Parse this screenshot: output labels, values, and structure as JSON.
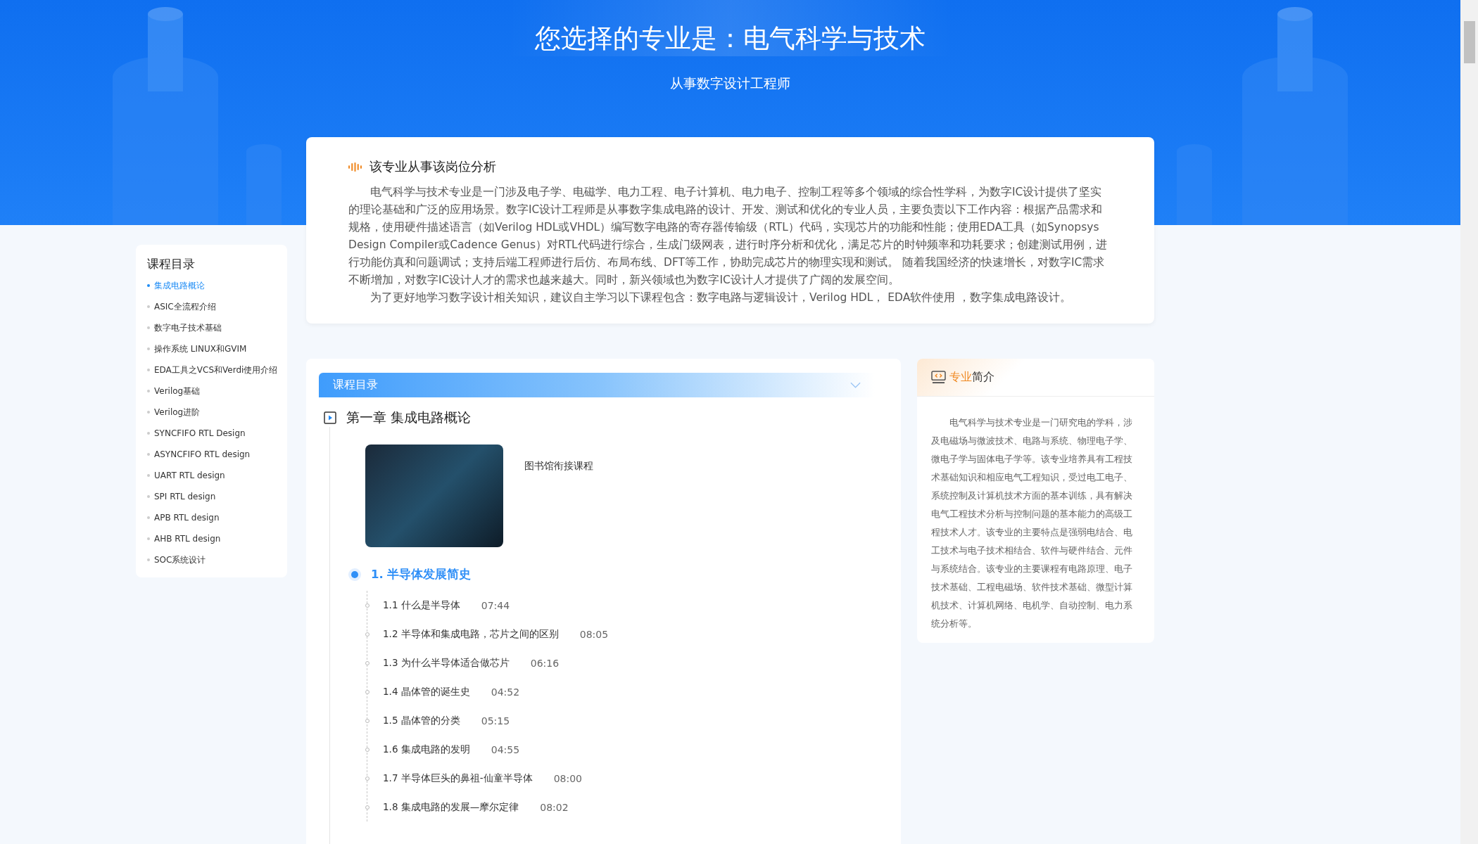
{
  "header": {
    "title": "您选择的专业是：电气科学与技术",
    "subtitle": "从事数字设计工程师"
  },
  "analysis": {
    "title": "该专业从事该岗位分析",
    "paragraphs": [
      "电气科学与技术专业是一门涉及电子学、电磁学、电力工程、电子计算机、电力电子、控制工程等多个领域的综合性学科，为数字IC设计提供了坚实的理论基础和广泛的应用场景。数字IC设计工程师是从事数字集成电路的设计、开发、测试和优化的专业人员，主要负责以下工作内容：根据产品需求和规格，使用硬件描述语言（如Verilog HDL或VHDL）编写数字电路的寄存器传输级（RTL）代码，实现芯片的功能和性能；使用EDA工具（如Synopsys Design Compiler或Cadence Genus）对RTL代码进行综合，生成门级网表，进行时序分析和优化，满足芯片的时钟频率和功耗要求；创建测试用例，进行功能仿真和问题调试；支持后端工程师进行后仿、布局布线、DFT等工作，协助完成芯片的物理实现和测试。 随着我国经济的快速增长，对数字IC需求不断增加，对数字IC设计人才的需求也越来越大。同时，新兴领域也为数字IC设计人才提供了广阔的发展空间。",
      "为了更好地学习数字设计相关知识，建议自主学习以下课程包含：数字电路与逻辑设计，Verilog HDL， EDA软件使用 ，数字集成电路设计。"
    ]
  },
  "sidebar": {
    "title": "课程目录",
    "items": [
      {
        "label": "集成电路概论",
        "selected": true
      },
      {
        "label": "ASIC全流程介绍",
        "selected": false
      },
      {
        "label": "数字电子技术基础",
        "selected": false
      },
      {
        "label": "操作系统 LINUX和GVIM",
        "selected": false
      },
      {
        "label": "EDA工具之VCS和Verdi使用介绍",
        "selected": false
      },
      {
        "label": "Verilog基础",
        "selected": false
      },
      {
        "label": "Verilog进阶",
        "selected": false
      },
      {
        "label": "SYNCFIFO RTL Design",
        "selected": false
      },
      {
        "label": "ASYNCFIFO RTL design",
        "selected": false
      },
      {
        "label": "UART RTL design",
        "selected": false
      },
      {
        "label": "SPI RTL design",
        "selected": false
      },
      {
        "label": "APB RTL design",
        "selected": false
      },
      {
        "label": "AHB RTL design",
        "selected": false
      },
      {
        "label": "SOC系统设计",
        "selected": false
      }
    ]
  },
  "course": {
    "header": "课程目录",
    "chapter": "第一章 集成电路概论",
    "library_label": "图书馆衔接课程",
    "section": {
      "title": "1. 半导体发展简史",
      "selected": true
    },
    "lessons": [
      {
        "title": "1.1 什么是半导体",
        "duration": "07:44"
      },
      {
        "title": "1.2 半导体和集成电路，芯片之间的区别",
        "duration": "08:05"
      },
      {
        "title": "1.3 为什么半导体适合做芯片",
        "duration": "06:16"
      },
      {
        "title": "1.4 晶体管的诞生史",
        "duration": "04:52"
      },
      {
        "title": "1.5 晶体管的分类",
        "duration": "05:15"
      },
      {
        "title": "1.6 集成电路的发明",
        "duration": "04:55"
      },
      {
        "title": "1.7 半导体巨头的鼻祖-仙童半导体",
        "duration": "08:00"
      },
      {
        "title": "1.8 集成电路的发展—摩尔定律",
        "duration": "08:02"
      }
    ]
  },
  "intro": {
    "title_accent": "专业",
    "title_rest": "简介",
    "text": "电气科学与技术专业是一门研究电的学科，涉及电磁场与微波技术、电路与系统、物理电子学、微电子学与固体电子学等。该专业培养具有工程技术基础知识和相应电气工程知识，受过电工电子、系统控制及计算机技术方面的基本训练，具有解决电气工程技术分析与控制问题的基本能力的高级工程技术人才。该专业的主要特点是强弱电结合、电工技术与电子技术相结合、软件与硬件结合、元件与系统结合。该专业的主要课程有电路原理、电子技术基础、工程电磁场、软件技术基础、微型计算机技术、计算机网络、电机学、自动控制、电力系统分析等。"
  }
}
